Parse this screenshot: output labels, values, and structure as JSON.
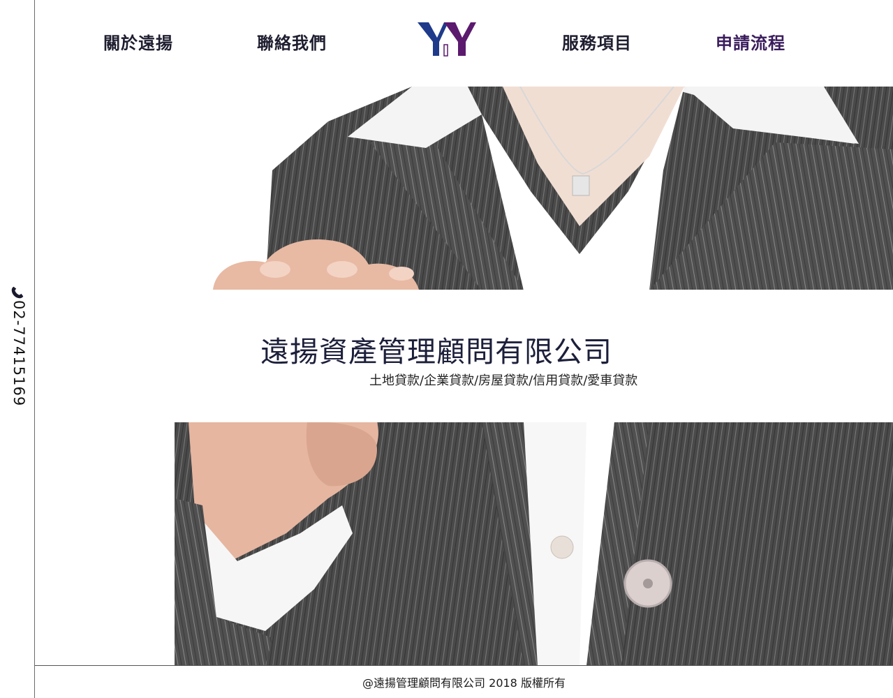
{
  "contact": {
    "phone_icon": "phone-icon",
    "phone": "02-77415169"
  },
  "nav": {
    "items": [
      {
        "label": "關於遠揚"
      },
      {
        "label": "聯絡我們"
      },
      {
        "label": "服務項目"
      },
      {
        "label": "申請流程"
      }
    ],
    "logo": {
      "text": "YY",
      "colors": [
        "#1f3a8a",
        "#5b1a6e"
      ]
    }
  },
  "hero": {
    "title": "遠揚資產管理顧問有限公司",
    "subtitle": "土地貸款/企業貸款/房屋貸款/信用貸款/愛車貸款"
  },
  "footer": {
    "copyright": "@遠揚管理顧問有限公司 2018  版權所有"
  },
  "colors": {
    "nav_text": "#1e1e30",
    "nav_accent": "#3a1c5c",
    "title": "#1c1f3a"
  }
}
